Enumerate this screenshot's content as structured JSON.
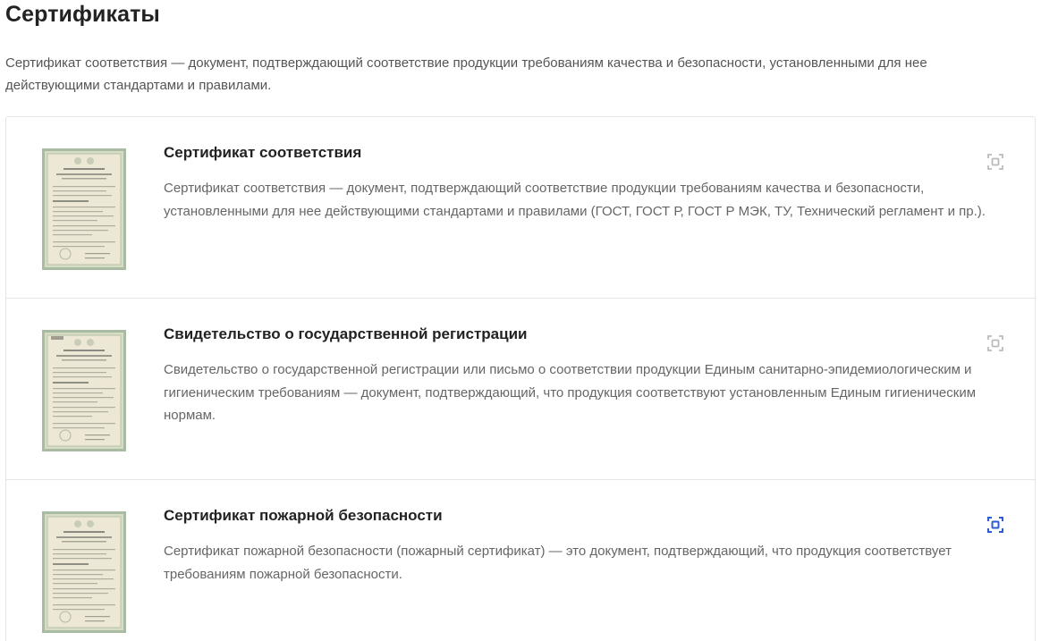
{
  "page": {
    "title": "Сертификаты",
    "intro": "Сертификат соответствия — документ, подтверждающий соответствие продукции требованиям качества и безопасности, установленными для нее действующими стандартами и правилами."
  },
  "certificates": [
    {
      "title": "Сертификат соответствия",
      "description": "Сертификат соответствия — документ, подтверждающий соответствие продукции требованиям качества и безопасности, установленными для нее действующими стандартами и правилами (ГОСТ, ГОСТ Р, ГОСТ Р МЭК, ТУ, Технический регламент и пр.).",
      "zoom_icon": "zoom-frame-icon",
      "zoom_color": "#bbbbbb"
    },
    {
      "title": "Свидетельство о государственной регистрации",
      "description": "Свидетельство о государственной регистрации или письмо о соответствии продукции Единым санитарно-эпидемиологическим и гигиеническим требованиям — документ, подтверждающий, что продукция соответствуют установленным Единым гигиеническим нормам.",
      "zoom_icon": "zoom-frame-icon",
      "zoom_color": "#bbbbbb"
    },
    {
      "title": "Сертификат пожарной безопасности",
      "description": "Сертификат пожарной безопасности (пожарный сертификат) — это документ, подтверждающий, что продукция соответствует требованиям пожарной безопасности.",
      "zoom_icon": "zoom-frame-icon",
      "zoom_color": "#2d5bd3"
    }
  ],
  "colors": {
    "thumb_border": "#9fb39a",
    "thumb_paper": "#e9e6d2",
    "zoom_inactive": "#bbbbbb",
    "zoom_active": "#2d5bd3"
  }
}
